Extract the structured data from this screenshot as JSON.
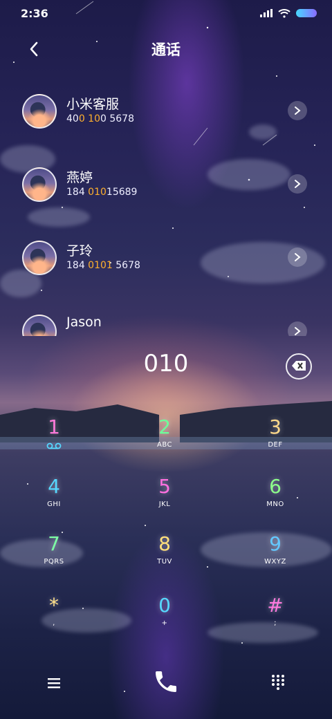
{
  "status": {
    "time": "2:36"
  },
  "header": {
    "title": "通话"
  },
  "contacts": [
    {
      "name": "小米客服",
      "number_parts": [
        "40",
        "0 10",
        "0 5678"
      ]
    },
    {
      "name": "燕婷",
      "number_parts": [
        "184 ",
        "010",
        "15689"
      ]
    },
    {
      "name": "子玲",
      "number_parts": [
        "184 ",
        "0101",
        " 5678"
      ]
    },
    {
      "name": "Jason",
      "number_parts": [
        "",
        "",
        ""
      ]
    }
  ],
  "dialer": {
    "input_value": "010",
    "keys": [
      {
        "digit": "1",
        "letters": "",
        "color": "#ff7ad9"
      },
      {
        "digit": "2",
        "letters": "ABC",
        "color": "#6dff9a"
      },
      {
        "digit": "3",
        "letters": "DEF",
        "color": "#ffd98a"
      },
      {
        "digit": "4",
        "letters": "GHI",
        "color": "#56d8ff"
      },
      {
        "digit": "5",
        "letters": "JKL",
        "color": "#ff6fe0"
      },
      {
        "digit": "6",
        "letters": "MNO",
        "color": "#8cff8a"
      },
      {
        "digit": "7",
        "letters": "PQRS",
        "color": "#7dffa5"
      },
      {
        "digit": "8",
        "letters": "TUV",
        "color": "#ffdf7a"
      },
      {
        "digit": "9",
        "letters": "WXYZ",
        "color": "#63c8ff"
      },
      {
        "digit": "*",
        "letters": ",",
        "color": "#ffe08a"
      },
      {
        "digit": "0",
        "letters": "+",
        "color": "#56d8ff"
      },
      {
        "digit": "#",
        "letters": ";",
        "color": "#ff7ae0"
      }
    ]
  },
  "icons": {
    "back": "chevron-left-icon",
    "detail": "chevron-right-icon",
    "backspace": "backspace-icon",
    "voicemail": "voicemail-icon",
    "menu": "menu-icon",
    "call": "phone-icon",
    "keypad": "dialpad-icon"
  },
  "colors": {
    "highlight": "#ffb02e",
    "battery": "#47d8ff"
  }
}
